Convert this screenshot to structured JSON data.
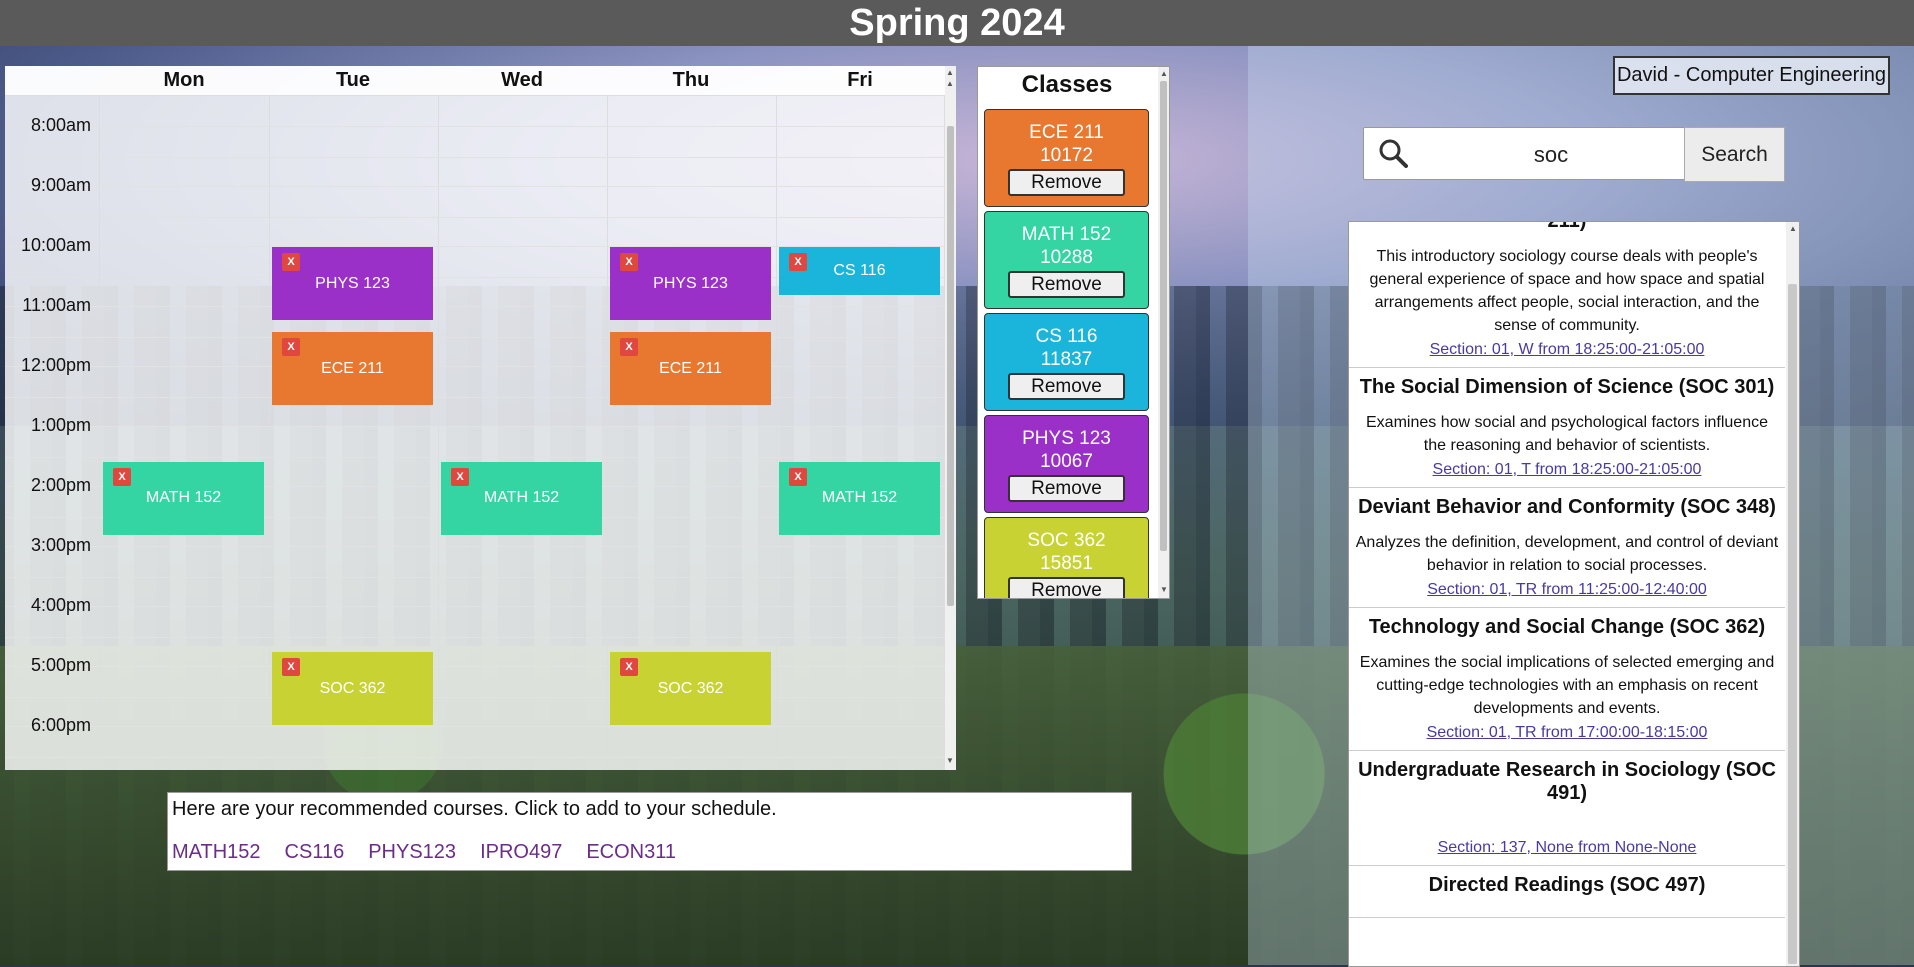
{
  "header": {
    "title": "Spring 2024"
  },
  "user": {
    "label": "David - Computer Engineering"
  },
  "calendar": {
    "days": [
      "Mon",
      "Tue",
      "Wed",
      "Thu",
      "Fri"
    ],
    "times": [
      "8:00am",
      "9:00am",
      "10:00am",
      "11:00am",
      "12:00pm",
      "1:00pm",
      "2:00pm",
      "3:00pm",
      "4:00pm",
      "5:00pm",
      "6:00pm"
    ],
    "remove_glyph": "X",
    "events": [
      {
        "label": "PHYS 123",
        "day": 1,
        "start": 10.0,
        "end": 11.25,
        "color": "#9b30c9"
      },
      {
        "label": "PHYS 123",
        "day": 3,
        "start": 10.0,
        "end": 11.25,
        "color": "#9b30c9"
      },
      {
        "label": "CS 116",
        "day": 4,
        "start": 10.0,
        "end": 10.83,
        "color": "#1bb5dc"
      },
      {
        "label": "ECE 211",
        "day": 1,
        "start": 11.42,
        "end": 12.67,
        "color": "#e8782f"
      },
      {
        "label": "ECE 211",
        "day": 3,
        "start": 11.42,
        "end": 12.67,
        "color": "#e8782f"
      },
      {
        "label": "MATH 152",
        "day": 0,
        "start": 13.58,
        "end": 14.83,
        "color": "#34d4a3"
      },
      {
        "label": "MATH 152",
        "day": 2,
        "start": 13.58,
        "end": 14.83,
        "color": "#34d4a3"
      },
      {
        "label": "MATH 152",
        "day": 4,
        "start": 13.58,
        "end": 14.83,
        "color": "#34d4a3"
      },
      {
        "label": "SOC 362",
        "day": 1,
        "start": 16.75,
        "end": 18.0,
        "color": "#c8d333"
      },
      {
        "label": "SOC 362",
        "day": 3,
        "start": 16.75,
        "end": 18.0,
        "color": "#c8d333"
      }
    ]
  },
  "classes": {
    "title": "Classes",
    "remove_label": "Remove",
    "items": [
      {
        "course": "ECE 211",
        "crn": "10172",
        "color": "#e8782f"
      },
      {
        "course": "MATH 152",
        "crn": "10288",
        "color": "#34d4a3"
      },
      {
        "course": "CS 116",
        "crn": "11837",
        "color": "#1bb5dc"
      },
      {
        "course": "PHYS 123",
        "crn": "10067",
        "color": "#9b30c9"
      },
      {
        "course": "SOC 362",
        "crn": "15851",
        "color": "#c8d333"
      }
    ]
  },
  "search": {
    "value": "soc",
    "button_label": "Search"
  },
  "results": [
    {
      "title": "211)",
      "desc": "This introductory sociology course deals with people's general experience of space and how space and spatial arrangements affect people, social interaction, and the sense of community.",
      "section": "Section: 01, W from 18:25:00-21:05:00"
    },
    {
      "title": "The Social Dimension of Science (SOC 301)",
      "desc": "Examines how social and psychological factors influence the reasoning and behavior of scientists.",
      "section": "Section: 01, T from 18:25:00-21:05:00"
    },
    {
      "title": "Deviant Behavior and Conformity (SOC 348)",
      "desc": "Analyzes the definition, development, and control of deviant behavior in relation to social processes.",
      "section": "Section: 01, TR from 11:25:00-12:40:00"
    },
    {
      "title": "Technology and Social Change (SOC 362)",
      "desc": "Examines the social implications of selected emerging and cutting-edge technologies with an emphasis on recent developments and events.",
      "section": "Section: 01, TR from 17:00:00-18:15:00"
    },
    {
      "title": "Undergraduate Research in Sociology (SOC 491)",
      "desc": "",
      "section": "Section: 137, None from None-None"
    },
    {
      "title": "Directed Readings (SOC 497)",
      "desc": "",
      "section": ""
    }
  ],
  "recommend": {
    "message": "Here are your recommended courses. Click to add to your schedule.",
    "courses": [
      "MATH152",
      "CS116",
      "PHYS123",
      "IPRO497",
      "ECON311"
    ]
  }
}
